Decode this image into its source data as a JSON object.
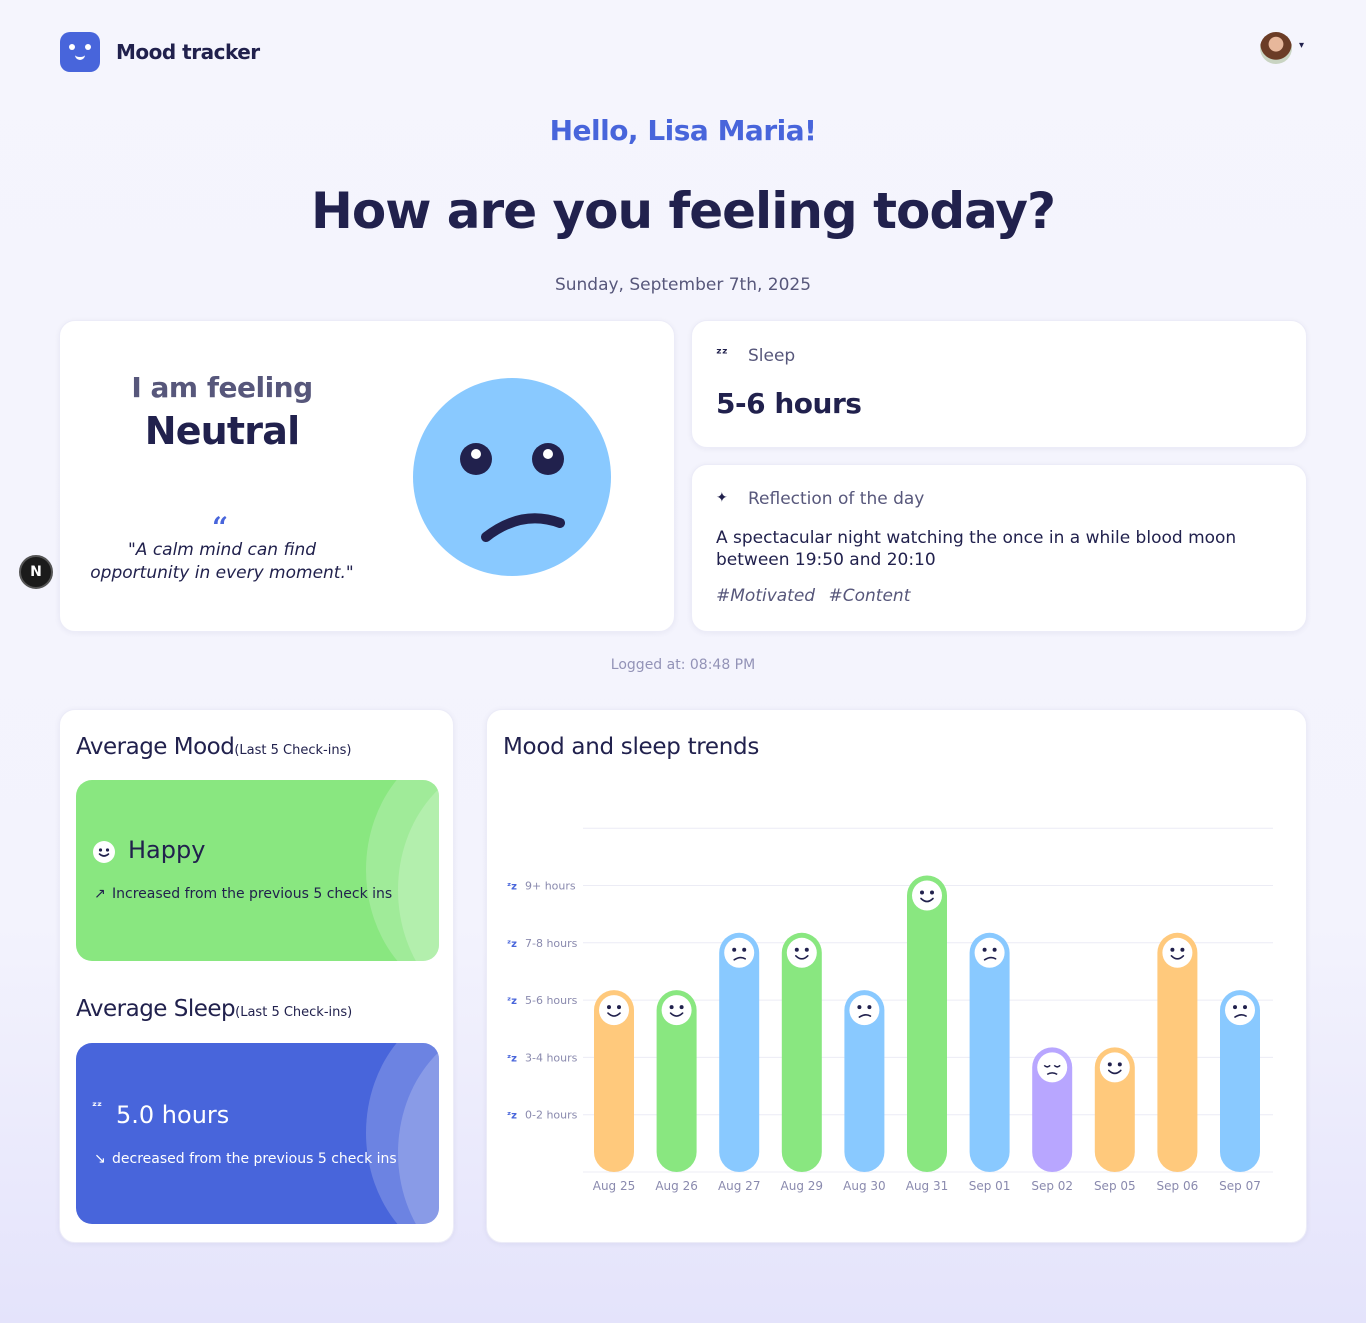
{
  "app": {
    "title": "Mood tracker"
  },
  "greeting": "Hello, Lisa Maria!",
  "question": "How are you feeling today?",
  "date": "Sunday, September 7th, 2025",
  "today": {
    "feeling_label": "I am feeling",
    "feeling_value": "Neutral",
    "quote": "\"A calm mind can find opportunity in every moment.\"",
    "face_color": "#89c9ff"
  },
  "sleep": {
    "label": "Sleep",
    "value": "5-6 hours"
  },
  "reflection": {
    "label": "Reflection of the day",
    "text": "A spectacular night watching the once in a while blood moon between 19:50 and 20:10",
    "tags": [
      "#Motivated",
      "#Content"
    ]
  },
  "logged": "Logged at: 08:48 PM",
  "avg_mood": {
    "title": "Average Mood",
    "subtitle": "(Last 5 Check-ins)",
    "value": "Happy",
    "trend": "Increased from the previous 5 check ins",
    "color": "#89e780"
  },
  "avg_sleep": {
    "title": "Average Sleep",
    "subtitle": "(Last 5 Check-ins)",
    "value": "5.0 hours",
    "trend": "decreased from the previous 5 check ins",
    "color": "#4865db"
  },
  "chart_data": {
    "type": "bar",
    "title": "Mood and sleep trends",
    "y_categories": [
      "0-2 hours",
      "3-4 hours",
      "5-6 hours",
      "7-8 hours",
      "9+ hours"
    ],
    "categories": [
      "Aug 25",
      "Aug 26",
      "Aug 27",
      "Aug 29",
      "Aug 30",
      "Aug 31",
      "Sep 01",
      "Sep 02",
      "Sep 05",
      "Sep 06",
      "Sep 07"
    ],
    "sleep_level": [
      3,
      3,
      4,
      4,
      3,
      5,
      4,
      2,
      2,
      4,
      3
    ],
    "mood": [
      "happy",
      "happy",
      "neutral",
      "happy",
      "neutral",
      "happy",
      "neutral",
      "sad",
      "happy",
      "very-happy",
      "neutral"
    ],
    "mood_colors": {
      "happy": "#89e780",
      "very-happy": "#ffc97c",
      "neutral": "#89c9ff",
      "sad": "#b8a6ff"
    },
    "bar_colors": [
      "#ffc97c",
      "#89e780",
      "#89c9ff",
      "#89e780",
      "#89c9ff",
      "#89e780",
      "#89c9ff",
      "#b8a6ff",
      "#ffc97c",
      "#ffc97c",
      "#89c9ff"
    ],
    "grid": true
  }
}
